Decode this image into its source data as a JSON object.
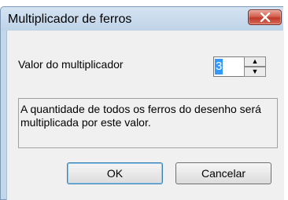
{
  "window": {
    "title": "Multiplicador de ferros"
  },
  "multiplier": {
    "label": "Valor do multiplicador",
    "value": "3",
    "up_glyph": "▲",
    "down_glyph": "▼"
  },
  "info": {
    "text": "A quantidade de todos os ferros do desenho será multiplicada por este valor."
  },
  "buttons": {
    "ok_label": "OK",
    "cancel_label": "Cancelar"
  },
  "colors": {
    "titlebar": "#c3d7ea",
    "close_button": "#c0392b",
    "selection": "#3399ff",
    "default_button_border": "#3c7fb1"
  },
  "icons": {
    "close": "close-icon",
    "spin_up": "arrow-up-icon",
    "spin_down": "arrow-down-icon"
  }
}
